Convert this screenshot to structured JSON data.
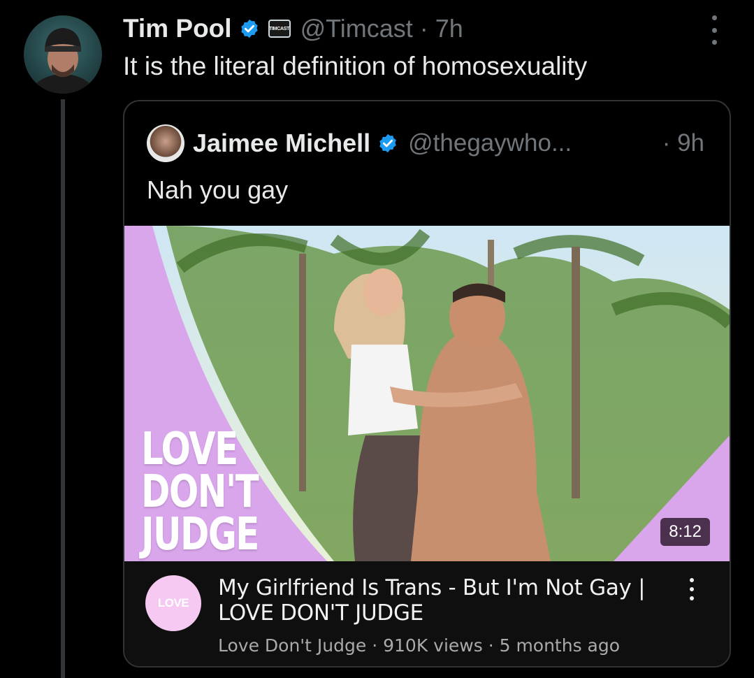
{
  "tweet": {
    "author_name": "Tim Pool",
    "affiliate_badge": "TIMCAST",
    "handle_time": "@Timcast · 7h",
    "text": "It is the literal definition of homosexuality",
    "avatar_icon": "user-avatar",
    "more_icon": "more-vertical-icon"
  },
  "quote": {
    "author_name": "Jaimee Michell",
    "handle": "@thegaywho...",
    "time": "· 9h",
    "text": "Nah you gay",
    "video": {
      "thumbnail_logo_lines": [
        "LOVE",
        "DON'T",
        "JUDGE"
      ],
      "duration": "8:12",
      "channel_logo_text": "LOVE",
      "title": "My Girlfriend Is Trans - But I'm Not Gay | LOVE DON'T JUDGE",
      "meta": "Love Don't Judge · 910K views · 5 months ago"
    }
  },
  "colors": {
    "background": "#000000",
    "text_primary": "#e7e9ea",
    "text_secondary": "#71767b",
    "verified_blue": "#1d9bf0",
    "thumbnail_pink": "#d9a6ec",
    "border": "#2f3336"
  }
}
